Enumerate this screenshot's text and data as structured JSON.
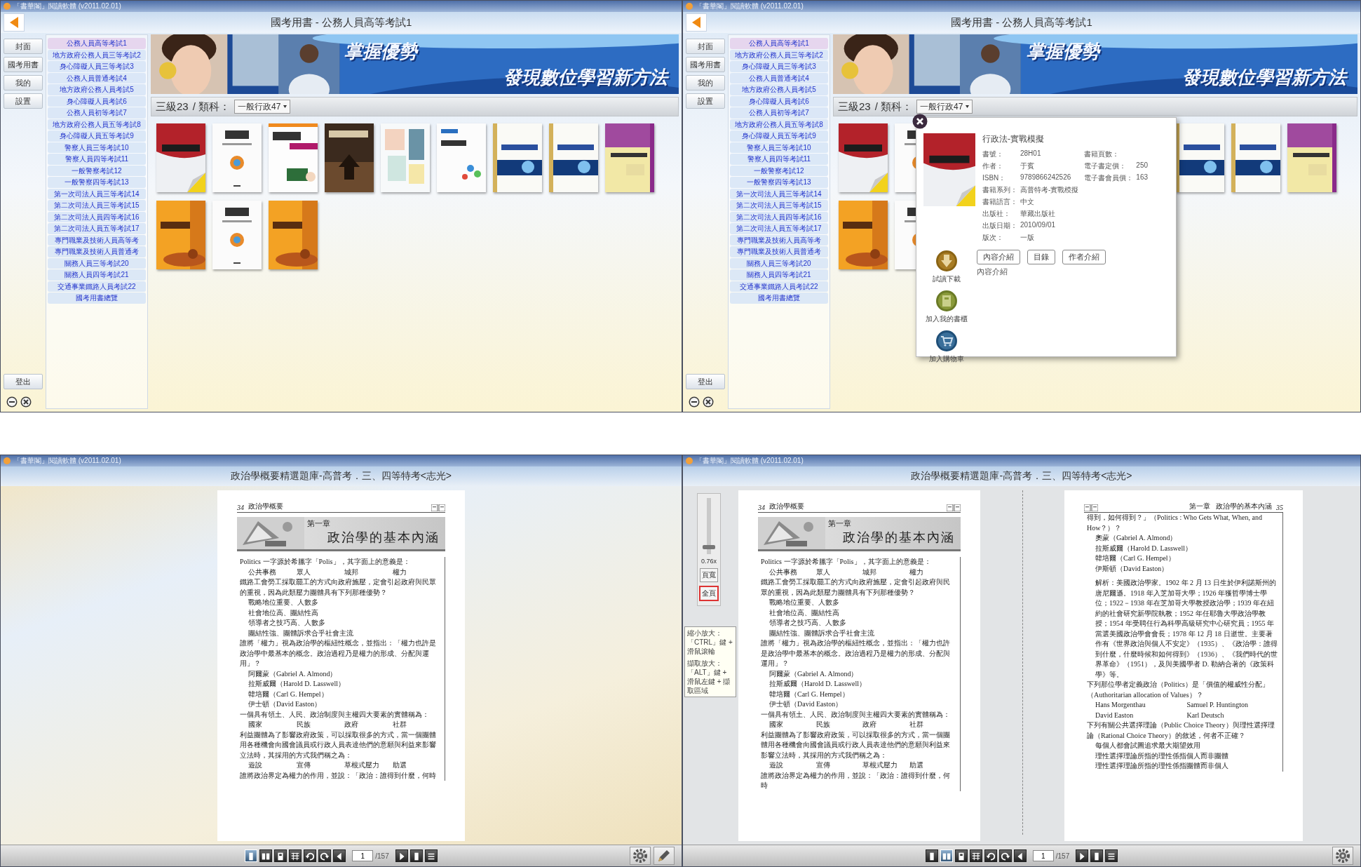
{
  "panels": [
    {
      "kind": "catalog",
      "app_title": "「書華閣」閱讀軟體 (v2011.02.01)",
      "title": "國考用書 - 公務人員高等考試1",
      "nav": [
        "封面",
        "國考用書",
        "我的",
        "設置"
      ],
      "exam_list": [
        {
          "label": "公務人員高等考試1",
          "selected": true
        },
        {
          "label": "地方政府公務人員三等考試2",
          "selected": false
        },
        {
          "label": "身心障礙人員三等考試3",
          "selected": false
        },
        {
          "label": "公務人員普通考試4",
          "selected": false
        },
        {
          "label": "地方政府公務人員考試5",
          "selected": false
        },
        {
          "label": "身心障礙人員考試6",
          "selected": false
        },
        {
          "label": "公務人員初等考試7",
          "selected": false
        },
        {
          "label": "地方政府公務人員五等考試8",
          "selected": false
        },
        {
          "label": "身心障礙人員五等考試9",
          "selected": false
        },
        {
          "label": "警察人員三等考試10",
          "selected": false
        },
        {
          "label": "警察人員四等考試11",
          "selected": false
        },
        {
          "label": "一般警察考試12",
          "selected": false
        },
        {
          "label": "一般警察四等考試13",
          "selected": false
        },
        {
          "label": "第一次司法人員三等考試14",
          "selected": false
        },
        {
          "label": "第二次司法人員三等考試15",
          "selected": false
        },
        {
          "label": "第二次司法人員四等考試16",
          "selected": false
        },
        {
          "label": "第二次司法人員五等考試17",
          "selected": false
        },
        {
          "label": "專門職業及技術人員高等考",
          "selected": false
        },
        {
          "label": "專門職業及技術人員普通考",
          "selected": false
        },
        {
          "label": "關務人員三等考試20",
          "selected": false
        },
        {
          "label": "關務人員四等考試21",
          "selected": false
        },
        {
          "label": "交通事業鐵路人員考試22",
          "selected": false
        },
        {
          "label": "國考用書總覽",
          "selected": false
        }
      ],
      "banner_text": [
        "掌握優勢",
        "發現數位學習新方法"
      ],
      "filter": {
        "grade": "三級23",
        "label": "/ 類科：",
        "value": "一般行政47"
      },
      "books": [
        {
          "kind": "picture"
        },
        {
          "kind": "picture"
        },
        {
          "kind": "picture"
        },
        {
          "kind": "picture"
        },
        {
          "kind": "picture"
        },
        {
          "kind": "picture"
        },
        {
          "kind": "picture"
        },
        {
          "kind": "picture"
        },
        {
          "kind": "picture"
        },
        {
          "kind": "picture"
        },
        {
          "kind": "picture"
        },
        {
          "kind": "picture"
        }
      ],
      "logout": "登出"
    },
    {
      "kind": "catalog",
      "app_title": "「書華閣」閱讀軟體 (v2011.02.01)",
      "title": "國考用書 - 公務人員高等考試1",
      "nav": [
        "封面",
        "國考用書",
        "我的",
        "設置"
      ],
      "exam_list": [
        {
          "label": "公務人員高等考試1",
          "selected": true
        },
        {
          "label": "地方政府公務人員三等考試2",
          "selected": false
        },
        {
          "label": "身心障礙人員三等考試3",
          "selected": false
        },
        {
          "label": "公務人員普通考試4",
          "selected": false
        },
        {
          "label": "地方政府公務人員考試5",
          "selected": false
        },
        {
          "label": "身心障礙人員考試6",
          "selected": false
        },
        {
          "label": "公務人員初等考試7",
          "selected": false
        },
        {
          "label": "地方政府公務人員五等考試8",
          "selected": false
        },
        {
          "label": "身心障礙人員五等考試9",
          "selected": false
        },
        {
          "label": "警察人員三等考試10",
          "selected": false
        },
        {
          "label": "警察人員四等考試11",
          "selected": false
        },
        {
          "label": "一般警察考試12",
          "selected": false
        },
        {
          "label": "一般警察四等考試13",
          "selected": false
        },
        {
          "label": "第一次司法人員三等考試14",
          "selected": false
        },
        {
          "label": "第二次司法人員三等考試15",
          "selected": false
        },
        {
          "label": "第二次司法人員四等考試16",
          "selected": false
        },
        {
          "label": "第二次司法人員五等考試17",
          "selected": false
        },
        {
          "label": "專門職業及技術人員高等考",
          "selected": false
        },
        {
          "label": "專門職業及技術人員普通考",
          "selected": false
        },
        {
          "label": "關務人員三等考試20",
          "selected": false
        },
        {
          "label": "關務人員四等考試21",
          "selected": false
        },
        {
          "label": "交通事業鐵路人員考試22",
          "selected": false
        },
        {
          "label": "國考用書總覽",
          "selected": false
        }
      ],
      "banner_text": [
        "掌握優勢",
        "發現數位學習新方法"
      ],
      "filter": {
        "grade": "三級23",
        "label": "/ 類科：",
        "value": "一般行政47"
      },
      "books": [
        {
          "kind": "picture"
        },
        {
          "kind": "picture"
        },
        {
          "kind": "hidden"
        },
        {
          "kind": "hidden"
        },
        {
          "kind": "hidden"
        },
        {
          "kind": "hidden"
        },
        {
          "kind": "picture"
        },
        {
          "kind": "picture"
        },
        {
          "kind": "picture"
        },
        {
          "kind": "picture"
        },
        {
          "kind": "picture"
        },
        {
          "kind": "hidden"
        }
      ],
      "logout": "登出",
      "popup": {
        "title": "行政法-實戰模擬",
        "details_left": [
          {
            "label": "書號：",
            "value": "28H01"
          },
          {
            "label": "作者：",
            "value": "于賓"
          },
          {
            "label": "ISBN：",
            "value": "9789866242526"
          },
          {
            "label": "書籍系列：",
            "value": "高普特考-實戰模擬"
          },
          {
            "label": "書籍語言：",
            "value": "中文"
          },
          {
            "label": "出版社：",
            "value": "華藏出版社"
          },
          {
            "label": "出版日期：",
            "value": "2010/09/01"
          },
          {
            "label": "版次：",
            "value": "一版"
          }
        ],
        "details_right": [
          {
            "label": "書籍頁數："
          },
          {
            "label": "電子書定價：",
            "value": "250"
          },
          {
            "label": "電子書會員價：",
            "value": "163"
          }
        ],
        "actions": [
          {
            "kind": "download",
            "label": "試讀下載"
          },
          {
            "kind": "shelf",
            "label": "加入我的書櫃"
          },
          {
            "kind": "cart",
            "label": "加入購物車"
          }
        ],
        "tabs": [
          "內容介紹",
          "目錄",
          "作者介紹"
        ],
        "section": "內容介紹"
      }
    },
    {
      "kind": "reader",
      "app_title": "「書華閣」閱讀軟體 (v2011.02.01)",
      "title": "政治學概要精選題庫-高普考．三、四等特考<志光>",
      "pages": [
        {
          "number": "34",
          "running_title": [
            "政治學概要"
          ],
          "chapter": {
            "label": "第一章",
            "title": "政治學的基本內涵"
          },
          "blocks": [
            {
              "kind": "para",
              "text": "Politics 一字源於希臘字「Polis」，其字面上的意義是："
            },
            {
              "kind": "options-row",
              "items": [
                "公共事務",
                "眾人",
                "城邦",
                "權力"
              ]
            },
            {
              "kind": "para",
              "text": "鐵路工會勞工採取罷工的方式向政府施壓，定會引起政府與民眾的重視，因為此類壓力團體具有下列那種優勢？"
            },
            {
              "kind": "option",
              "text": "戰略地位重要、人數多"
            },
            {
              "kind": "option",
              "text": "社會地位高、團結性高"
            },
            {
              "kind": "option",
              "text": "領導者之技巧高、人數多"
            },
            {
              "kind": "option",
              "text": "團結性強、團體訴求合乎社會主流"
            },
            {
              "kind": "para",
              "text": "誰將「權力」視為政治學的樞紐性概念，並指出：「權力也許是政治學中最基本的概念。政治過程乃是權力的形成、分配與運用」？"
            },
            {
              "kind": "option",
              "text": "阿爾蒙（Gabriel A. Almond）"
            },
            {
              "kind": "option",
              "text": "拉斯威爾（Harold D. Lasswell）"
            },
            {
              "kind": "option",
              "text": "韓培爾（Carl G. Hempel）"
            },
            {
              "kind": "option",
              "text": "伊士頓（David Easton）"
            },
            {
              "kind": "para",
              "text": "一個具有領土、人民、政治制度與主權四大要素的實體稱為："
            },
            {
              "kind": "options-row",
              "items": [
                "國家",
                "民族",
                "政府",
                "社群"
              ]
            },
            {
              "kind": "para",
              "text": "利益團體為了影響政府政策，可以採取很多的方式，當一個團體用各種機會向國會議員或行政人員表達他們的意願與利益來影響立法時，其採用的方式我們稱之為："
            },
            {
              "kind": "options-row",
              "items": [
                "遊說",
                "宣傳",
                "草根式壓力",
                "助選"
              ]
            },
            {
              "kind": "para",
              "text": "誰將政治界定為權力的作用，並說：「政治：誰得到什麼，何時"
            }
          ]
        }
      ],
      "toolbar": {
        "views": [
          {
            "kind": "single",
            "selected": true
          },
          {
            "kind": "double",
            "selected": false
          },
          {
            "kind": "cover",
            "selected": false
          },
          {
            "kind": "grid",
            "selected": false
          }
        ],
        "nav_before": [
          {
            "kind": "undo"
          },
          {
            "kind": "redo"
          },
          {
            "kind": "prev"
          }
        ],
        "page": "1",
        "total": "/157",
        "nav_after": [
          {
            "kind": "next"
          },
          {
            "kind": "end"
          },
          {
            "kind": "menu"
          }
        ],
        "tools": [
          {
            "kind": "settings"
          },
          {
            "kind": "pen"
          }
        ]
      }
    },
    {
      "kind": "reader",
      "app_title": "「書華閣」閱讀軟體 (v2011.02.01)",
      "title": "政治學概要精選題庫-高普考．三、四等特考<志光>",
      "zoom": {
        "level": 0.1,
        "reading": "0.76x",
        "buttons": [
          {
            "label": "頁寬",
            "selected": false
          },
          {
            "label": "全頁",
            "selected": true
          }
        ],
        "tooltip": [
          "縮小放大：「CTRL」鍵 + 滑鼠滾輪",
          "擷取放大：「ALT」鍵 + 滑鼠左鍵 + 擷取區域"
        ]
      },
      "pages": [
        {
          "number": "34",
          "running_title": [
            "政治學概要"
          ],
          "chapter": {
            "label": "第一章",
            "title": "政治學的基本內涵"
          },
          "blocks": [
            {
              "kind": "para",
              "text": "Politics 一字源於希臘字「Polis」，其字面上的意義是："
            },
            {
              "kind": "options-row",
              "items": [
                "公共事務",
                "眾人",
                "城邦",
                "權力"
              ]
            },
            {
              "kind": "para",
              "text": "鐵路工會勞工採取罷工的方式向政府施壓，定會引起政府與民眾的重視，因為此類壓力團體具有下列那種優勢？"
            },
            {
              "kind": "option",
              "text": "戰略地位重要、人數多"
            },
            {
              "kind": "option",
              "text": "社會地位高、團結性高"
            },
            {
              "kind": "option",
              "text": "領導者之技巧高、人數多"
            },
            {
              "kind": "option",
              "text": "團結性強、團體訴求合乎社會主流"
            },
            {
              "kind": "para",
              "text": "誰將「權力」視為政治學的樞紐性概念，並指出：「權力也許是政治學中最基本的概念。政治過程乃是權力的形成、分配與運用」？"
            },
            {
              "kind": "option",
              "text": "阿爾蒙（Gabriel A. Almond）"
            },
            {
              "kind": "option",
              "text": "拉斯威爾（Harold D. Lasswell）"
            },
            {
              "kind": "option",
              "text": "韓培爾（Carl G. Hempel）"
            },
            {
              "kind": "option",
              "text": "伊士頓（David Easton）"
            },
            {
              "kind": "para",
              "text": "一個具有領土、人民、政治制度與主權四大要素的實體稱為："
            },
            {
              "kind": "options-row",
              "items": [
                "國家",
                "民族",
                "政府",
                "社群"
              ]
            },
            {
              "kind": "para",
              "text": "利益團體為了影響政府政策，可以採取很多的方式，當一個團體用各種機會向國會議員或行政人員表達他們的意願與利益來影響立法時，其採用的方式我們稱之為："
            },
            {
              "kind": "options-row",
              "items": [
                "遊說",
                "宣傳",
                "草根式壓力",
                "助選"
              ]
            },
            {
              "kind": "para",
              "text": "誰將政治界定為權力的作用，並說：「政治：誰得到什麼，何時"
            }
          ]
        },
        {
          "number": "35",
          "running_title": [
            "第一章",
            "政治學的基本內涵"
          ],
          "blocks": [
            {
              "kind": "para",
              "text": "得到，如何得到？」（Politics : Who Gets What, When, and How？）？"
            },
            {
              "kind": "option",
              "text": "奧蒙（Gabriel A. Almond）"
            },
            {
              "kind": "option",
              "text": "拉斯威爾（Harold D. Lasswell）"
            },
            {
              "kind": "option",
              "text": "韓培爾（Carl G. Hempel）"
            },
            {
              "kind": "option",
              "text": "伊斯頓（David Easton）"
            },
            {
              "kind": "note",
              "text": "解析：美國政治學家。1902 年 2 月 13 日生於伊利諾斯州的唐尼爾遜。1918 年入芝加哥大學；1926 年獲哲學博士學位；1922－1938 年在芝加哥大學教授政治學；1939 年在紐約的社會研究新學院執教；1952 年任耶魯大學政治學教授；1954 年受聘任行為科學高級研究中心研究員；1955 年當選美國政治學會會長；1978 年 12 月 18 日逝世。主要著作有《世界政治與個人不安定》（1935）、《政治學：誰得到什麼，什麼時候和如何得到》（1936）、《我們時代的世界革命》（1951），及與美國學者 D. 勒納合著的《政策科學》等。"
            },
            {
              "kind": "para",
              "text": "下列那位學者定義政治（Politics）是「價值的權威性分配」（Authoritarian allocation of Values）？"
            },
            {
              "kind": "options-grid",
              "items": [
                "Hans Morgenthau",
                "Samuel P. Huntington",
                "David Easton",
                "Karl Deutsch"
              ]
            },
            {
              "kind": "para",
              "text": "下列有關公共選擇理論（Public Choice Theory）與理性選擇理論（Rational Choice Theory）的敘述，何者不正確？"
            },
            {
              "kind": "option",
              "text": "每個人都會試圖追求最大期望效用"
            },
            {
              "kind": "option",
              "text": "理性選擇理論所指的理性係指個人而非團體"
            },
            {
              "kind": "option",
              "text": "理性選擇理論所指的理性係指團體而非個人"
            }
          ]
        }
      ],
      "toolbar": {
        "views": [
          {
            "kind": "single",
            "selected": false
          },
          {
            "kind": "double",
            "selected": true
          },
          {
            "kind": "cover",
            "selected": false
          },
          {
            "kind": "grid",
            "selected": false
          }
        ],
        "nav_before": [
          {
            "kind": "undo"
          },
          {
            "kind": "redo"
          },
          {
            "kind": "prev"
          }
        ],
        "page": "1",
        "total": "/157",
        "nav_after": [
          {
            "kind": "next"
          },
          {
            "kind": "end"
          },
          {
            "kind": "menu"
          }
        ],
        "tools": [
          {
            "kind": "settings"
          }
        ]
      }
    }
  ]
}
